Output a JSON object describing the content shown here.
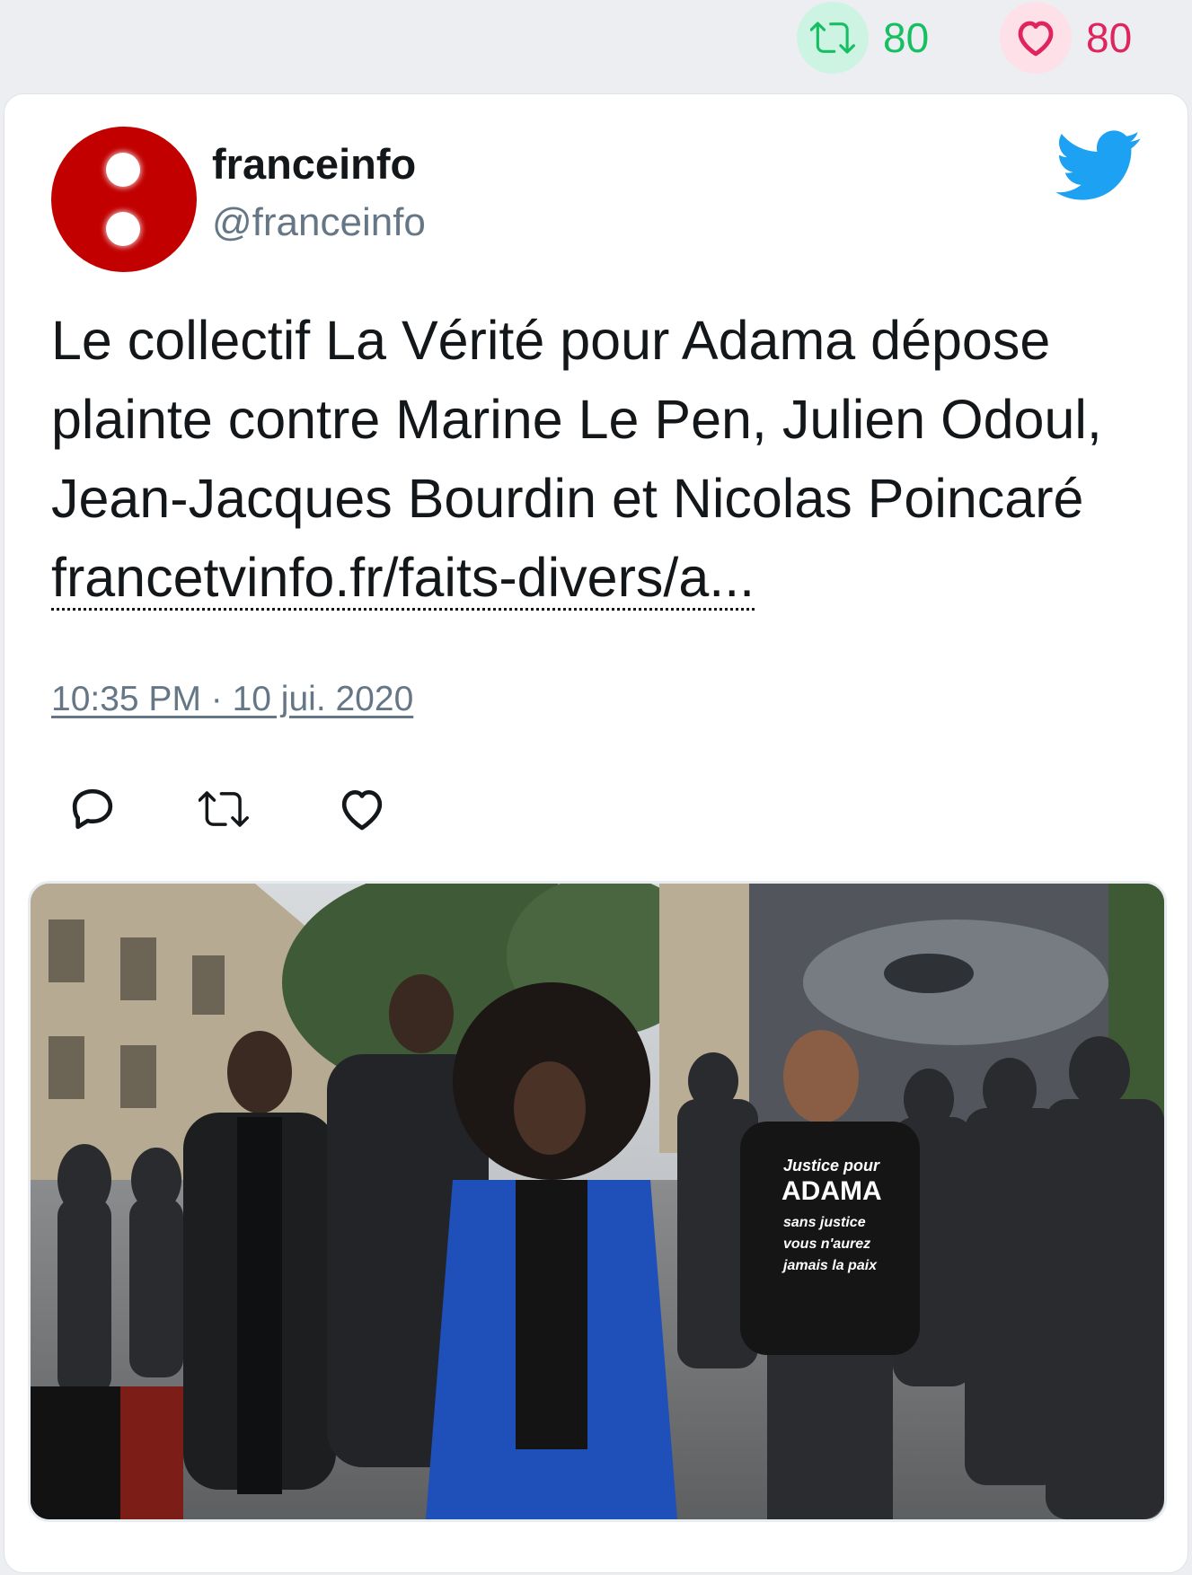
{
  "stats": {
    "retweets": "80",
    "likes": "80",
    "retweet_icon": "retweet-icon",
    "like_icon": "heart-icon",
    "retweet_color": "#17bf63",
    "like_color": "#e0245e"
  },
  "tweet": {
    "author_name": "franceinfo",
    "author_handle": "@franceinfo",
    "text": "Le collectif La Vérité pour Adama dépose plainte contre Marine Le Pen, Julien Odoul, Jean-Jacques Bourdin et Nicolas Poincaré ",
    "link_text": "francetvinfo.fr/faits-divers/a...",
    "timestamp": "10:35 PM · 10 jui. 2020",
    "brand_color": "#1da1f2",
    "avatar_color": "#c20000"
  },
  "photo": {
    "shirt_text_1": "Justice pour",
    "shirt_text_2": "ADAMA",
    "shirt_text_3": "sans justice",
    "shirt_text_4": "vous n'aurez",
    "shirt_text_5": "jamais la paix"
  }
}
